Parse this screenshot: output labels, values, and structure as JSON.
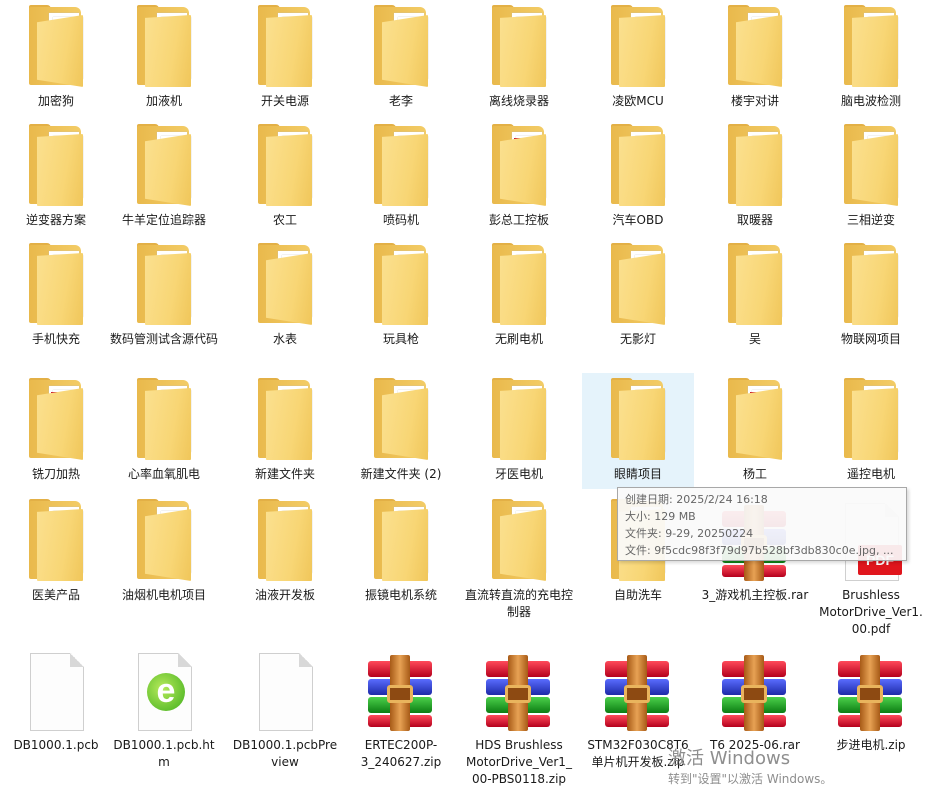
{
  "items": [
    {
      "label": "加密狗",
      "type": "folder",
      "badge": "doc"
    },
    {
      "label": "加液机",
      "type": "folder",
      "badge": "pdf"
    },
    {
      "label": "开关电源",
      "type": "folder",
      "badge": "pdf"
    },
    {
      "label": "老李",
      "type": "folder",
      "badge": "doc"
    },
    {
      "label": "离线烧录器",
      "type": "folder",
      "badge": "pdf"
    },
    {
      "label": "凌欧MCU",
      "type": "folder",
      "badge": "pdf"
    },
    {
      "label": "楼宇对讲",
      "type": "folder",
      "badge": "pdf"
    },
    {
      "label": "脑电波检测",
      "type": "folder",
      "badge": "doc"
    },
    {
      "label": "逆变器方案",
      "type": "folder",
      "badge": "photo"
    },
    {
      "label": "牛羊定位追踪器",
      "type": "folder",
      "badge": "none"
    },
    {
      "label": "农工",
      "type": "folder",
      "badge": "rar"
    },
    {
      "label": "喷码机",
      "type": "folder",
      "badge": "doc"
    },
    {
      "label": "彭总工控板",
      "type": "folder",
      "badge": "rar"
    },
    {
      "label": "汽车OBD",
      "type": "folder",
      "badge": "doc"
    },
    {
      "label": "取暖器",
      "type": "folder",
      "badge": "doc"
    },
    {
      "label": "三相逆变",
      "type": "folder",
      "badge": "none"
    },
    {
      "label": "手机快充",
      "type": "folder",
      "badge": "pdf"
    },
    {
      "label": "数码管测试含源代码",
      "type": "folder",
      "badge": "rar"
    },
    {
      "label": "水表",
      "type": "folder",
      "badge": "pdf"
    },
    {
      "label": "玩具枪",
      "type": "folder",
      "badge": "pdf"
    },
    {
      "label": "无刷电机",
      "type": "folder",
      "badge": "doc"
    },
    {
      "label": "无影灯",
      "type": "folder",
      "badge": "doc"
    },
    {
      "label": "吴",
      "type": "folder",
      "badge": "pdf"
    },
    {
      "label": "物联网项目",
      "type": "folder",
      "badge": "pdf"
    },
    {
      "label": "铣刀加热",
      "type": "folder",
      "badge": "rar"
    },
    {
      "label": "心率血氧肌电",
      "type": "folder",
      "badge": "pdf"
    },
    {
      "label": "新建文件夹",
      "type": "folder",
      "badge": "none"
    },
    {
      "label": "新建文件夹 (2)",
      "type": "folder",
      "badge": "doc"
    },
    {
      "label": "牙医电机",
      "type": "folder",
      "badge": "pdf"
    },
    {
      "label": "眼睛项目",
      "type": "folder",
      "badge": "doc",
      "selected": true
    },
    {
      "label": "杨工",
      "type": "folder",
      "badge": "rar"
    },
    {
      "label": "遥控电机",
      "type": "folder",
      "badge": "pdf"
    },
    {
      "label": "医美产品",
      "type": "folder",
      "badge": "doc"
    },
    {
      "label": "油烟机电机项目",
      "type": "folder",
      "badge": "pdf"
    },
    {
      "label": "油液开发板",
      "type": "folder",
      "badge": "rar"
    },
    {
      "label": "振镜电机系统",
      "type": "folder",
      "badge": "none"
    },
    {
      "label": "直流转直流的充电控制器",
      "type": "folder",
      "badge": "doc"
    },
    {
      "label": "自助洗车",
      "type": "folder",
      "badge": "doc"
    },
    {
      "label": "3_游戏机主控板.rar",
      "type": "rar"
    },
    {
      "label": "Brushless MotorDrive_Ver1.00.pdf",
      "type": "pdf"
    },
    {
      "label": "DB1000.1.pcb",
      "type": "file"
    },
    {
      "label": "DB1000.1.pcb.htm",
      "type": "htm"
    },
    {
      "label": "DB1000.1.pcbPreview",
      "type": "file"
    },
    {
      "label": "ERTEC200P-3_240627.zip",
      "type": "rar"
    },
    {
      "label": "HDS Brushless MotorDrive_Ver1_00-PBS0118.zip",
      "type": "rar"
    },
    {
      "label": "STM32F030C8T6单片机开发板.zip",
      "type": "rar"
    },
    {
      "label": "T6 2025-06.rar",
      "type": "rar"
    },
    {
      "label": "步进电机.zip",
      "type": "rar"
    }
  ],
  "tooltip": {
    "lines": [
      "创建日期: 2025/2/24 16:18",
      "大小: 129 MB",
      "文件夹: 9-29, 20250224",
      "文件: 9f5cdc98f3f79d97b528bf3db830c0e.jpg, ..."
    ]
  },
  "watermark": {
    "title": "激活 Windows",
    "subtitle": "转到\"设置\"以激活 Windows。"
  },
  "pdf_badge_text": "PDF",
  "htm_icon_letter": "e"
}
